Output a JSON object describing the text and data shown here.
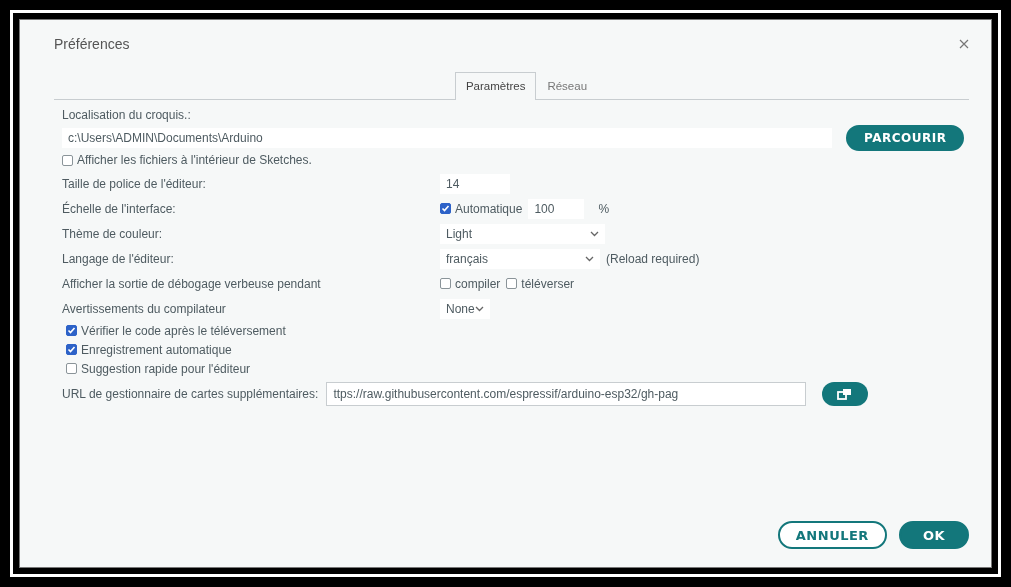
{
  "dialog": {
    "title": "Préférences"
  },
  "tabs": [
    {
      "label": "Paramètres",
      "selected": true
    },
    {
      "label": "Réseau",
      "selected": false
    }
  ],
  "sketchbook": {
    "label": "Localisation du croquis.:",
    "value": "c:\\Users\\ADMIN\\Documents\\Arduino",
    "button": "PARCOURIR"
  },
  "show_files": {
    "label": "Afficher les fichiers à l'intérieur de Sketches.",
    "checked": false
  },
  "settings": [
    {
      "kind": "text",
      "label": "Taille de police de l'éditeur:",
      "value": "14"
    },
    {
      "kind": "scale",
      "label": "Échelle de l'interface:",
      "auto_label": "Automatique",
      "checked": true,
      "value": "100",
      "unit": "%"
    },
    {
      "kind": "select",
      "label": "Thème de couleur:",
      "value": "Light"
    },
    {
      "kind": "select",
      "label": "Langage de l'éditeur:",
      "value": "français",
      "note": "(Reload required)"
    },
    {
      "kind": "checks",
      "label": "Afficher la sortie de débogage verbeuse pendant",
      "options": [
        {
          "label": "compiler",
          "checked": false
        },
        {
          "label": "téléverser",
          "checked": false
        }
      ]
    },
    {
      "kind": "select",
      "label": "Avertissements du compilateur",
      "value": "None"
    }
  ],
  "options": [
    {
      "label": "Vérifier le code après le téléversement",
      "checked": true
    },
    {
      "label": "Enregistrement automatique",
      "checked": true
    },
    {
      "label": "Suggestion rapide pour l'éditeur",
      "checked": false
    }
  ],
  "board_urls": {
    "label": "URL de gestionnaire de cartes supplémentaires:",
    "value": "ttps://raw.githubusercontent.com/espressif/arduino-esp32/gh-pag"
  },
  "buttons": [
    {
      "label": "ANNULER",
      "kind": "secondary"
    },
    {
      "label": "OK",
      "kind": "primary"
    }
  ]
}
